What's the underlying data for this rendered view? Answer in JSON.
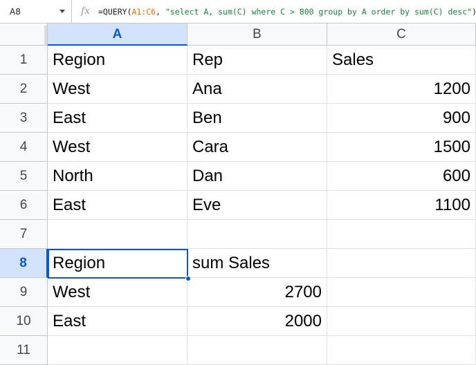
{
  "formula_bar": {
    "name_box": "A8",
    "fx_label": "fx",
    "formula_prefix": "=QUERY(",
    "formula_range": "A1:C6",
    "formula_rest_1": ", ",
    "formula_string": "\"select A, sum(C) where C > 800 group by A order by sum(C) desc\"",
    "formula_suffix": ")"
  },
  "columns": [
    "A",
    "B",
    "C"
  ],
  "selected": {
    "column": "A",
    "row": "8",
    "cell": "A8"
  },
  "rows": [
    {
      "n": "1",
      "cells": [
        "Region",
        "Rep",
        "Sales"
      ]
    },
    {
      "n": "2",
      "cells": [
        "West",
        "Ana",
        "1200"
      ]
    },
    {
      "n": "3",
      "cells": [
        "East",
        "Ben",
        "900"
      ]
    },
    {
      "n": "4",
      "cells": [
        "West",
        "Cara",
        "1500"
      ]
    },
    {
      "n": "5",
      "cells": [
        "North",
        "Dan",
        "600"
      ]
    },
    {
      "n": "6",
      "cells": [
        "East",
        "Eve",
        "1100"
      ]
    },
    {
      "n": "7",
      "cells": [
        "",
        "",
        ""
      ]
    },
    {
      "n": "8",
      "cells": [
        "Region",
        "sum Sales",
        ""
      ]
    },
    {
      "n": "9",
      "cells": [
        "West",
        "2700",
        ""
      ]
    },
    {
      "n": "10",
      "cells": [
        "East",
        "2000",
        ""
      ]
    },
    {
      "n": "11",
      "cells": [
        "",
        "",
        ""
      ]
    }
  ],
  "colors": {
    "selection": "#0b57d0",
    "header_selected_bg": "#d3e3fd",
    "header_bg": "#f8f9fa"
  }
}
